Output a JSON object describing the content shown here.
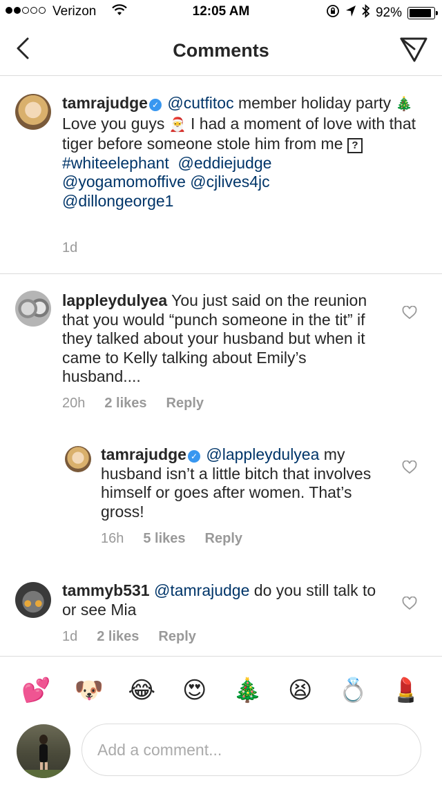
{
  "status_bar": {
    "carrier": "Verizon",
    "time": "12:05 AM",
    "battery": "92%",
    "battery_level": 0.92,
    "icons": [
      "wifi-icon",
      "orientation-lock-icon",
      "location-arrow-icon",
      "bluetooth-icon"
    ]
  },
  "nav": {
    "title": "Comments",
    "back_icon": "chevron-left-icon",
    "share_icon": "paper-plane-icon"
  },
  "caption": {
    "username": "tamrajudge",
    "verified": true,
    "mention1": "@cutfitoc",
    "text1": " member holiday party ",
    "emoji1": "🎄",
    "text2": "  Love you guys ",
    "emoji2": "🎅",
    "text3": "  I had a moment of love with that tiger before someone stole him from me ",
    "box": "?",
    "hashtag": "#whiteelephant",
    "mention2": "@eddiejudge",
    "mention3": "@yogamomoffive",
    "mention4": "@cjlives4jc",
    "mention5": "@dillongeorge1",
    "time": "1d"
  },
  "comments": [
    {
      "username": "lappleydulyea",
      "text": " You just said on the reunion that you would “punch someone in the tit” if they talked about your husband but when it came to Kelly talking about Emily’s husband....",
      "time": "20h",
      "likes": "2 likes",
      "reply": "Reply"
    },
    {
      "username": "tamrajudge",
      "verified": true,
      "mention": "@lappleydulyea",
      "text": " my husband isn’t a little bitch that involves himself or goes after women.  That’s gross!",
      "time": "16h",
      "likes": "5 likes",
      "reply": "Reply"
    },
    {
      "username": "tammyb531",
      "mention": "@tamrajudge",
      "text": " do you still talk to or see Mia",
      "time": "1d",
      "likes": "2 likes",
      "reply": "Reply"
    }
  ],
  "emoji_bar": [
    "💕",
    "🐶",
    "😂",
    "😍",
    "🎄",
    "😫",
    "💍",
    "💄"
  ],
  "composer": {
    "placeholder": "Add a comment..."
  },
  "colors": {
    "mention": "#003569",
    "verified": "#3897f0",
    "meta_gray": "#999999",
    "divider": "#dbdbdb"
  }
}
